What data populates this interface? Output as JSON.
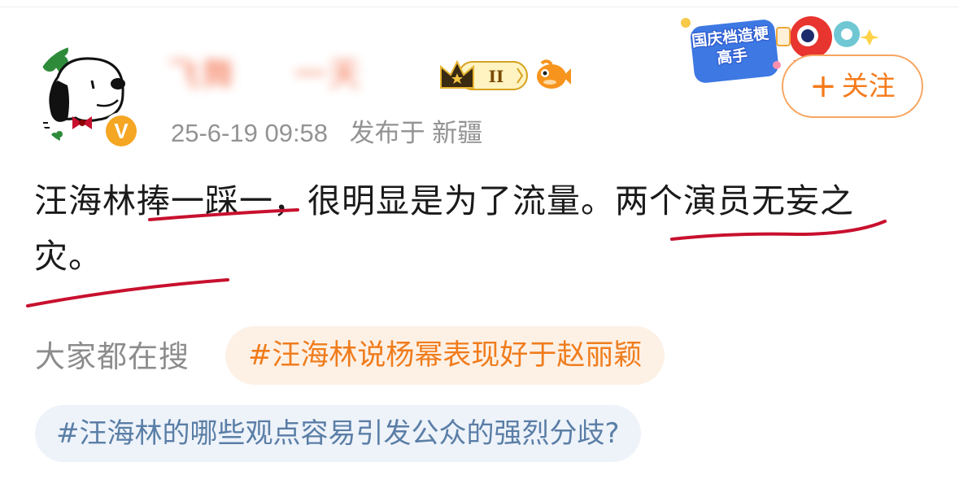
{
  "post": {
    "author": {
      "name": "飞舞 　 一天",
      "level_badge": "II",
      "verified_mark": "V"
    },
    "time": "25-6-19 09:58",
    "location": "发布于 新疆",
    "follow_label": "关注",
    "follow_plus": "+",
    "promo_sticker": "国庆档造梗高手",
    "content_part1": "汪海林捧一踩一，很明显是为了流量。",
    "content_part2": "两个演员无妄之灾。",
    "annotation_color": "#c8102e"
  },
  "hot_search": {
    "label": "大家都在搜",
    "tags": [
      "#汪海林说杨幂表现好于赵丽颖",
      "#汪海林的哪些观点容易引发公众的强烈分歧?"
    ]
  },
  "colors": {
    "accent_orange": "#f57a1a",
    "tag_orange_bg": "#fdf1e6",
    "tag_blue_bg": "#eef3fa",
    "tag_blue_text": "#5a7ea6"
  }
}
